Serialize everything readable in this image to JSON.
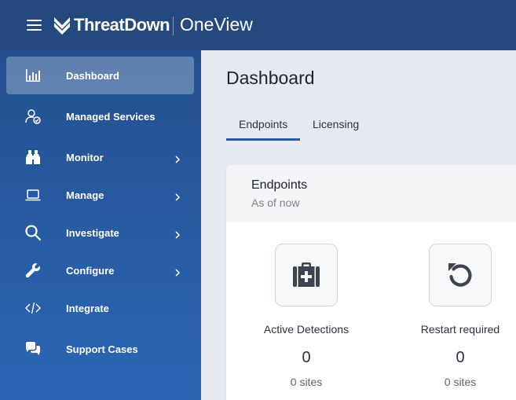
{
  "header": {
    "brand": "ThreatDown",
    "product": "OneView"
  },
  "sidebar": {
    "items": [
      {
        "label": "Dashboard",
        "icon": "bar-chart-icon",
        "active": true,
        "submenu": false
      },
      {
        "label": "Managed Services",
        "icon": "user-check-icon",
        "active": false,
        "submenu": false
      },
      {
        "label": "Monitor",
        "icon": "binoculars-icon",
        "active": false,
        "submenu": true
      },
      {
        "label": "Manage",
        "icon": "laptop-icon",
        "active": false,
        "submenu": true
      },
      {
        "label": "Investigate",
        "icon": "search-icon",
        "active": false,
        "submenu": true
      },
      {
        "label": "Configure",
        "icon": "wrench-icon",
        "active": false,
        "submenu": true
      },
      {
        "label": "Integrate",
        "icon": "code-icon",
        "active": false,
        "submenu": false
      },
      {
        "label": "Support Cases",
        "icon": "chat-bubbles-icon",
        "active": false,
        "submenu": false
      }
    ]
  },
  "main": {
    "title": "Dashboard",
    "tabs": [
      {
        "label": "Endpoints",
        "active": true
      },
      {
        "label": "Licensing",
        "active": false
      }
    ],
    "card": {
      "title": "Endpoints",
      "subtitle": "As of now",
      "stats": [
        {
          "label": "Active Detections",
          "value": "0",
          "sites": "0 sites",
          "icon": "medical-kit-icon"
        },
        {
          "label": "Restart required",
          "value": "0",
          "sites": "0 sites",
          "icon": "restart-icon"
        }
      ]
    }
  },
  "colors": {
    "header_bg": "#23497f",
    "sidebar_top": "#23508f",
    "sidebar_bottom": "#2b66b5",
    "accent": "#2c5a9c"
  }
}
